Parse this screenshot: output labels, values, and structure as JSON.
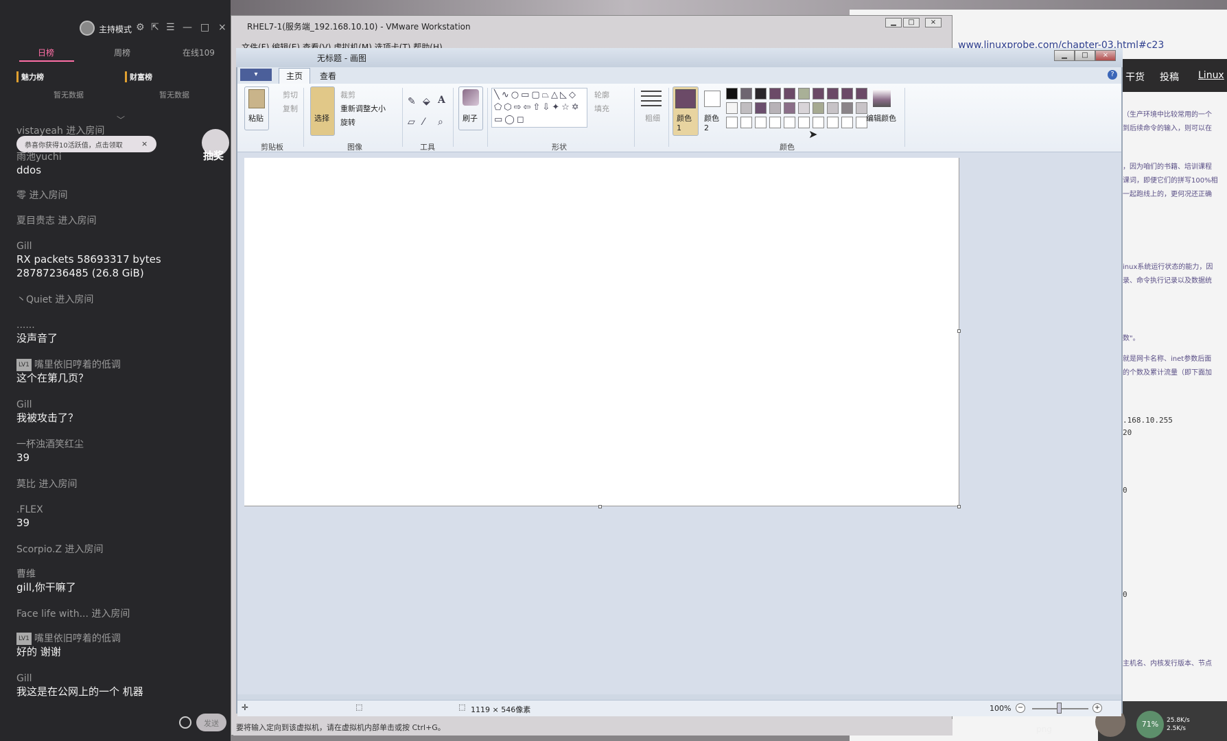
{
  "chat": {
    "host_mode": "主持模式",
    "tabs": [
      "日榜",
      "周榜",
      "在线109"
    ],
    "rank_left": "魅力榜",
    "rank_right": "财富榜",
    "nodata_left": "暂无数据",
    "nodata_right": "暂无数据",
    "toast": "恭喜你获得10活跃值，点击领取",
    "toast_close": "×",
    "lottery": "抽奖",
    "messages": [
      {
        "name": "vistayeah 进入房间",
        "text": ""
      },
      {
        "name": "雨池yuchi",
        "text": "ddos"
      },
      {
        "name": "零 进入房间",
        "text": ""
      },
      {
        "name": "夏目贵志 进入房间",
        "text": ""
      },
      {
        "name": "Gill",
        "text": "RX packets 58693317  bytes 28787236485  (26.8 GiB)"
      },
      {
        "name": "丶Quiet 进入房间",
        "text": ""
      },
      {
        "name": "......",
        "text": "没声音了"
      },
      {
        "name": "嘴里依旧哼着的低调",
        "text": "这个在第几页？",
        "lv": "LV1"
      },
      {
        "name": "Gill",
        "text": "我被攻击了？"
      },
      {
        "name": "一杯浊酒笑红尘",
        "text": "39"
      },
      {
        "name": "莫比 进入房间",
        "text": ""
      },
      {
        "name": ".FLEX",
        "text": "39"
      },
      {
        "name": "Scorpio.Z 进入房间",
        "text": ""
      },
      {
        "name": "曹维",
        "text": "gill,你干嘛了"
      },
      {
        "name": "Face life with... 进入房间",
        "text": ""
      },
      {
        "name": "嘴里依旧哼着的低调",
        "text": "好的 谢谢",
        "lv": "LV1"
      },
      {
        "name": "Gill",
        "text": "我这是在公网上的一个 机器"
      }
    ],
    "send_label": "发送"
  },
  "vmware": {
    "title": "RHEL7-1(服务端_192.168.10.10) - VMware Workstation",
    "menu": "文件(F)   编辑(E)   查看(V)   虚拟机(M)   选项卡(T)   帮助(H)",
    "status_hint": "要将输入定向到该虚拟机，请在虚拟机内部单击或按 Ctrl+G。"
  },
  "paint": {
    "title": "无标题 - 画图",
    "file_menu": "▾",
    "tabs": {
      "home": "主页",
      "view": "查看"
    },
    "clipboard": {
      "paste": "粘贴",
      "cut": "剪切",
      "copy": "复制",
      "group": "剪贴板"
    },
    "image": {
      "select": "选择",
      "crop": "裁剪",
      "resize": "重新调整大小",
      "rotate": "旋转",
      "group": "图像"
    },
    "tools": {
      "group": "工具",
      "text_tool": "A"
    },
    "brushes": {
      "label": "刷子"
    },
    "shapes": {
      "group": "形状",
      "outline": "轮廓",
      "fill": "填充",
      "glyphs": "╲∿○▭▢⏢△◺◇⬠⬡⇨⇦⇧⇩✦☆✡▭◯◻"
    },
    "size": {
      "label": "粗细"
    },
    "colors": {
      "color1": "颜色 1",
      "color2": "颜色 2",
      "edit": "编辑颜色",
      "group": "颜色",
      "palette": [
        "#111111",
        "#6e6670",
        "#2a262a",
        "#6b4a67",
        "#6b4a67",
        "#a9b097",
        "#6b4a67",
        "#6b4a67",
        "#6b4a67",
        "#6b4a67",
        "#f4f4f4",
        "#c0bdc0",
        "#6a4e6d",
        "#b7b2b7",
        "#8a6e88",
        "#d8d4d8",
        "#a6aa92",
        "#c7c3c7",
        "#8a8489",
        "#c8c4c8",
        "#ffffff",
        "#ffffff",
        "#ffffff",
        "#ffffff",
        "#ffffff",
        "#ffffff",
        "#ffffff",
        "#ffffff",
        "#ffffff",
        "#ffffff"
      ],
      "color1_hex": "#6b4a67"
    },
    "status": {
      "size": "1119 × 546像素",
      "zoom": "100%"
    }
  },
  "browser": {
    "url": "www.linuxprobe.com/chapter-03.html#c23",
    "nav": [
      "干货",
      "投稿",
      "Linux"
    ],
    "lines": [
      "（生产环境中比较常用的一个",
      "到后续命令的输入，则可以在",
      "，因为咱们的书籍、培训课程",
      "课词，即便它们的拼写100%相",
      "一起跑线上的，更何况还正确",
      "inux系统运行状态的能力，因",
      "录、命令执行记录以及数据统",
      "数\"。",
      "就是网卡名称、inet参数后面",
      "的个数及累计流量（即下面加",
      "主机名、内核发行版本、节点"
    ],
    "mono": [
      ".168.10.255",
      "20",
      "0",
      "0"
    ]
  },
  "taskbar": {
    "png": "png",
    "cpu": "71%",
    "up": "25.8K/s",
    "down": "2.5K/s"
  }
}
